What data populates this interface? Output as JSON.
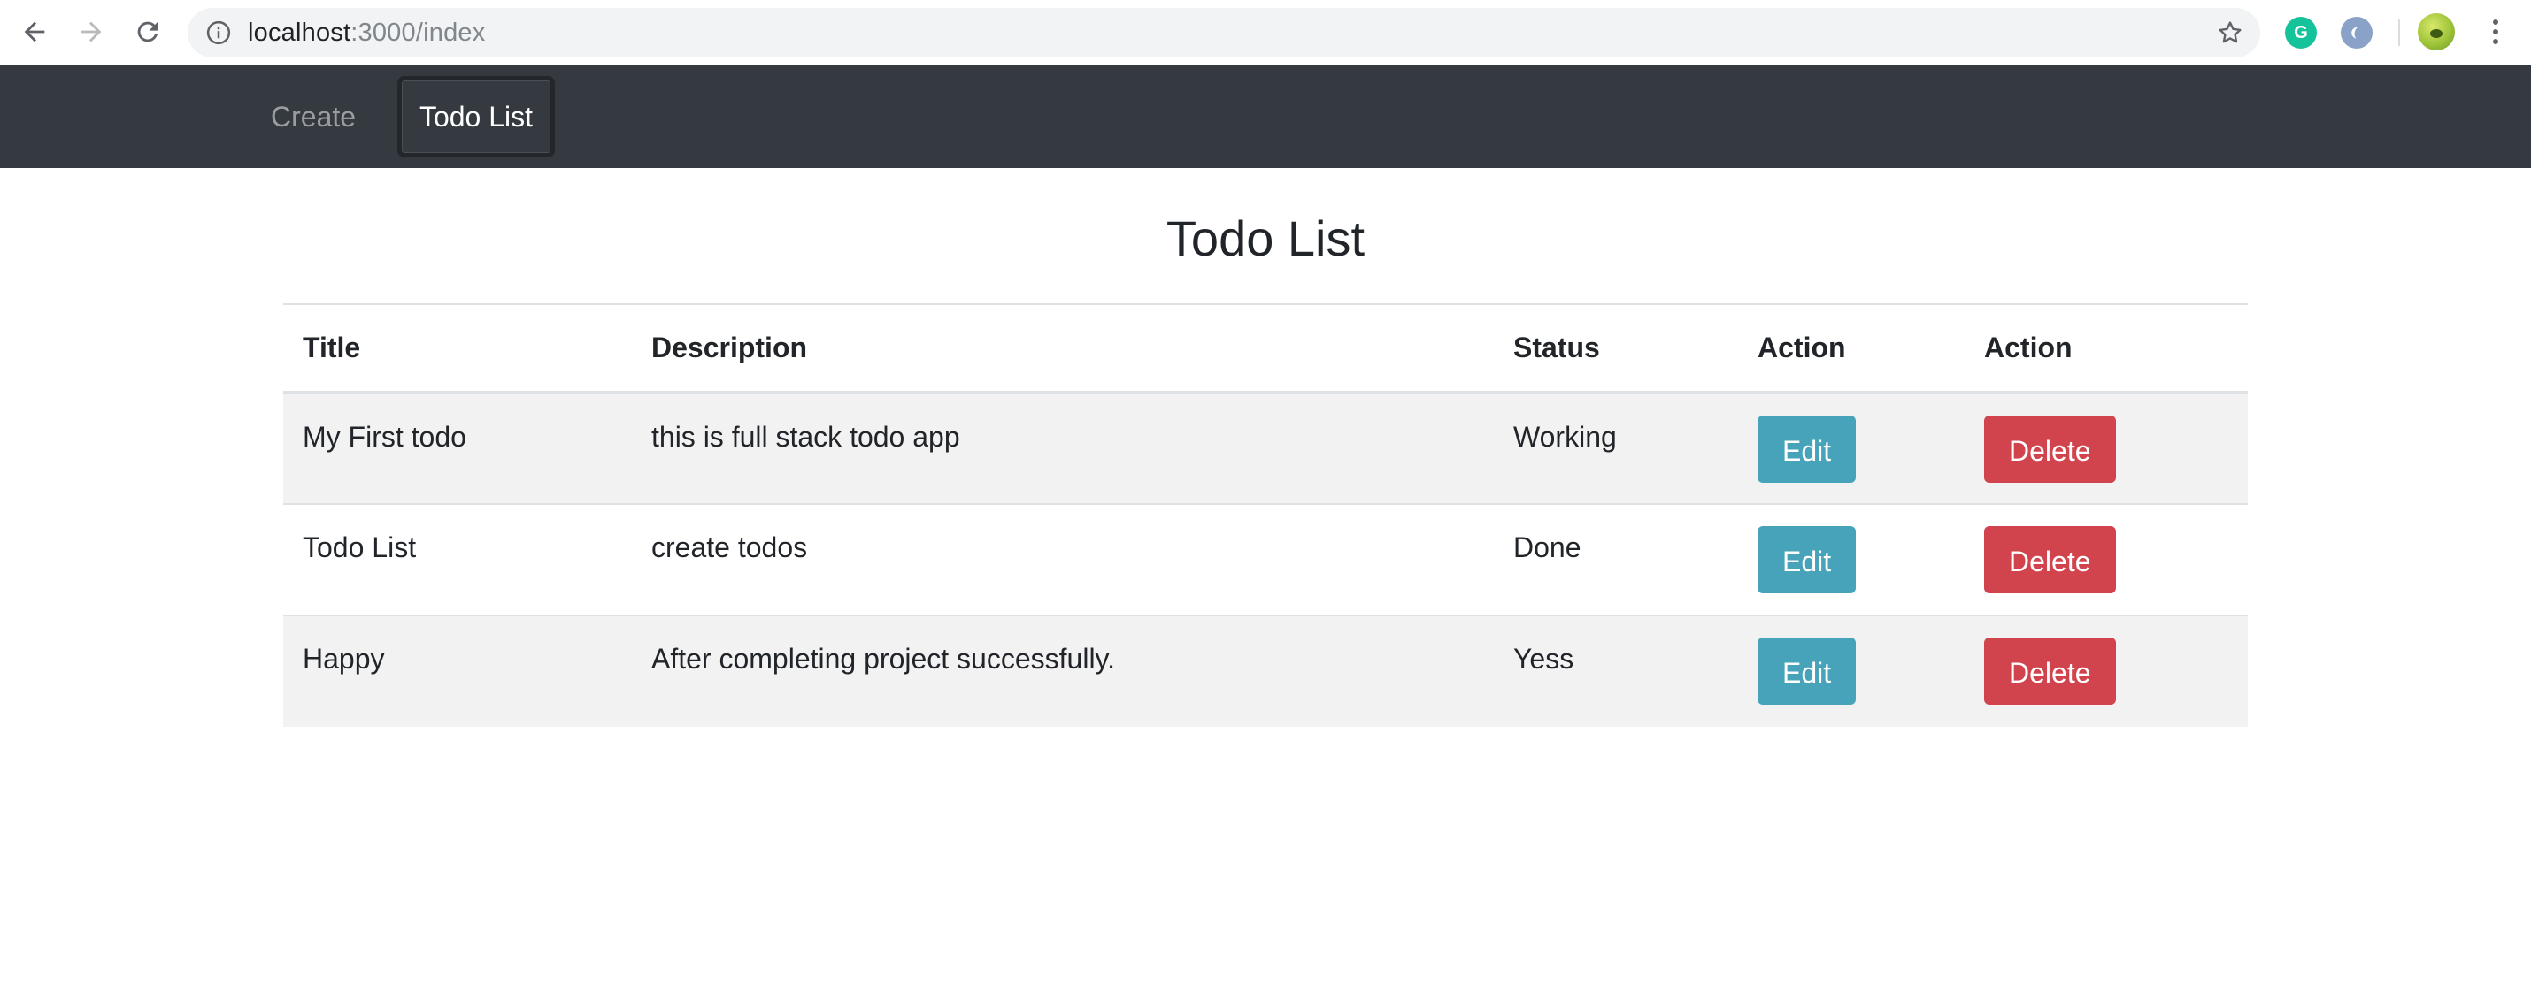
{
  "browser": {
    "url_host": "localhost",
    "url_path": ":3000/index"
  },
  "navbar": {
    "links": [
      {
        "label": "Create"
      },
      {
        "label": "Todo List"
      }
    ]
  },
  "page": {
    "title": "Todo List"
  },
  "table": {
    "headers": [
      "Title",
      "Description",
      "Status",
      "Action",
      "Action"
    ],
    "rows": [
      {
        "title": "My First todo",
        "description": "this is full stack todo app",
        "status": "Working",
        "edit_label": "Edit",
        "delete_label": "Delete"
      },
      {
        "title": "Todo List",
        "description": "create todos",
        "status": "Done",
        "edit_label": "Edit",
        "delete_label": "Delete"
      },
      {
        "title": "Happy",
        "description": "After completing project successfully.",
        "status": "Yess",
        "edit_label": "Edit",
        "delete_label": "Delete"
      }
    ]
  },
  "colors": {
    "navbar_bg": "#343a40",
    "edit_button": "#46a3b9",
    "delete_button": "#d1444d",
    "striped_row": "#f2f2f2"
  },
  "icons": [
    "back-arrow-icon",
    "forward-arrow-icon",
    "reload-icon",
    "info-icon",
    "star-icon",
    "grammarly-extension-icon",
    "extension-icon",
    "profile-avatar",
    "menu-dots-icon"
  ]
}
